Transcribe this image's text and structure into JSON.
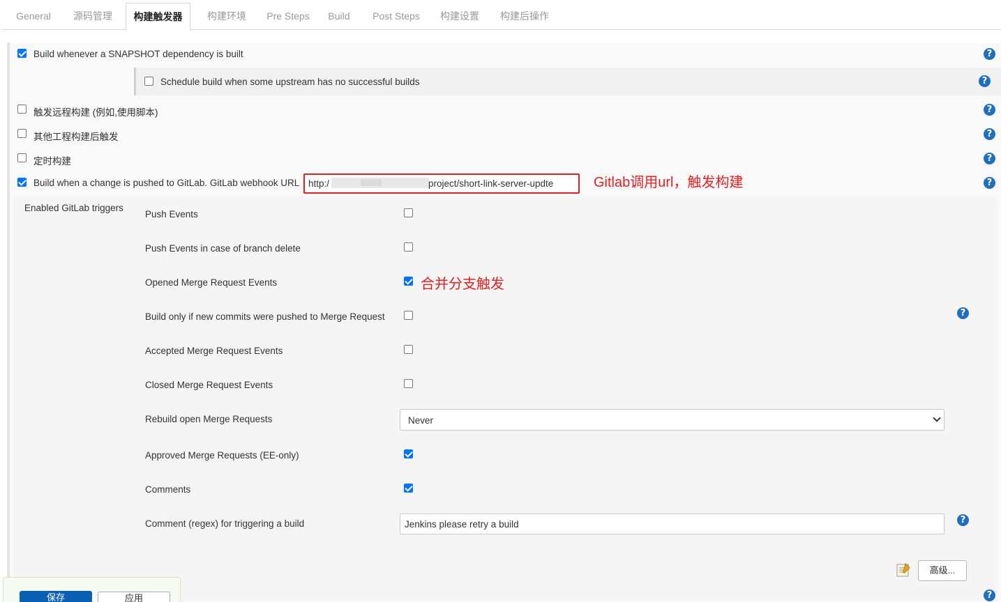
{
  "tabs": [
    {
      "label": "General"
    },
    {
      "label": "源码管理"
    },
    {
      "label": "构建触发器"
    },
    {
      "label": "构建环境"
    },
    {
      "label": "Pre Steps"
    },
    {
      "label": "Build"
    },
    {
      "label": "Post Steps"
    },
    {
      "label": "构建设置"
    },
    {
      "label": "构建后操作"
    }
  ],
  "active_tab": "构建触发器",
  "triggers": {
    "snapshot": {
      "label": "Build whenever a SNAPSHOT dependency is built",
      "checked": true
    },
    "upstream": {
      "label": "Schedule build when some upstream has no successful builds",
      "checked": false
    },
    "remote": {
      "label": "触发远程构建 (例如,使用脚本)",
      "checked": false
    },
    "other_project": {
      "label": "其他工程构建后触发",
      "checked": false
    },
    "periodic": {
      "label": "定时构建",
      "checked": false
    },
    "gitlab": {
      "label": "Build when a change is pushed to GitLab. GitLab webhook URL",
      "url_prefix": "http:/",
      "url_suffix": "project/short-link-server-updte",
      "checked": true
    }
  },
  "annotations": {
    "url_note": "Gitlab调用url，触发构建",
    "merge_note": "合并分支触发"
  },
  "gitlab_triggers": {
    "section_label": "Enabled GitLab triggers",
    "push_events": {
      "label": "Push Events",
      "checked": false
    },
    "push_branch_delete": {
      "label": "Push Events in case of branch delete",
      "checked": false
    },
    "opened_mr": {
      "label": "Opened Merge Request Events",
      "checked": true
    },
    "new_commits_mr": {
      "label": "Build only if new commits were pushed to Merge Request",
      "checked": false
    },
    "accepted_mr": {
      "label": "Accepted Merge Request Events",
      "checked": false
    },
    "closed_mr": {
      "label": "Closed Merge Request Events",
      "checked": false
    },
    "rebuild_open_mr": {
      "label": "Rebuild open Merge Requests",
      "value": "Never"
    },
    "approved_mr": {
      "label": "Approved Merge Requests (EE-only)",
      "checked": true
    },
    "comments": {
      "label": "Comments",
      "checked": true
    },
    "comment_regex": {
      "label": "Comment (regex) for triggering a build",
      "value": "Jenkins please retry a build"
    }
  },
  "buttons": {
    "advanced": "高级...",
    "save": "保存",
    "apply": "应用"
  },
  "icons": {
    "help": "?"
  },
  "colors": {
    "checkbox": "#0075ff",
    "help": "#1f6fbf",
    "annotation": "#e02020",
    "save_button": "#0b5fb0"
  }
}
